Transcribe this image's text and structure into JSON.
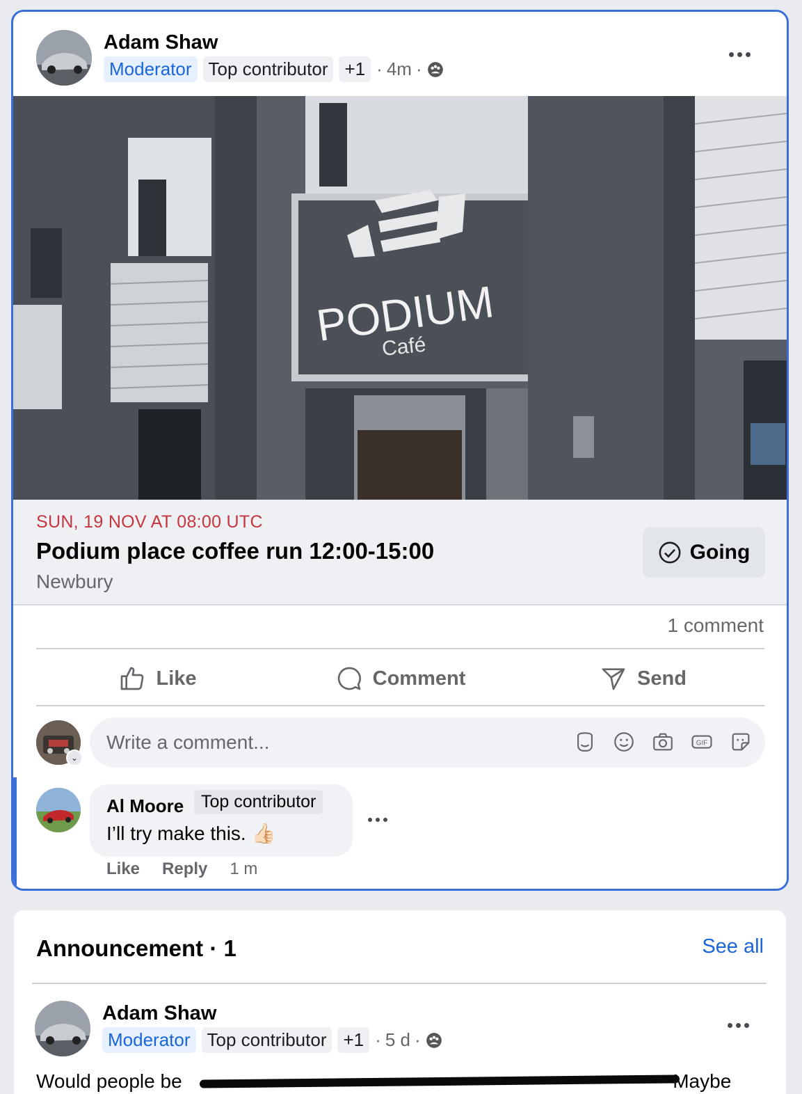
{
  "post": {
    "author": "Adam Shaw",
    "badges": {
      "moderator": "Moderator",
      "top": "Top contributor",
      "plus": "+1"
    },
    "time": "4m",
    "event": {
      "date": "SUN, 19 NOV AT 08:00 UTC",
      "title": "Podium place coffee run 12:00-15:00",
      "location": "Newbury",
      "going_label": "Going"
    },
    "photo_sign": {
      "brand": "PODIUM",
      "sub": "Café"
    },
    "comment_count": "1 comment",
    "actions": {
      "like": "Like",
      "comment": "Comment",
      "send": "Send"
    },
    "write_placeholder": "Write a comment...",
    "comment": {
      "author": "Al Moore",
      "badge": "Top contributor",
      "text": "I’ll try make this.",
      "emoji": "👍🏻",
      "like": "Like",
      "reply": "Reply",
      "time": "1 m"
    }
  },
  "announcement": {
    "title": "Announcement · 1",
    "see_all": "See all",
    "author": "Adam Shaw",
    "badges": {
      "moderator": "Moderator",
      "top": "Top contributor",
      "plus": "+1"
    },
    "time": "5 d",
    "text_start": "Would people be",
    "text_end": "Maybe"
  }
}
